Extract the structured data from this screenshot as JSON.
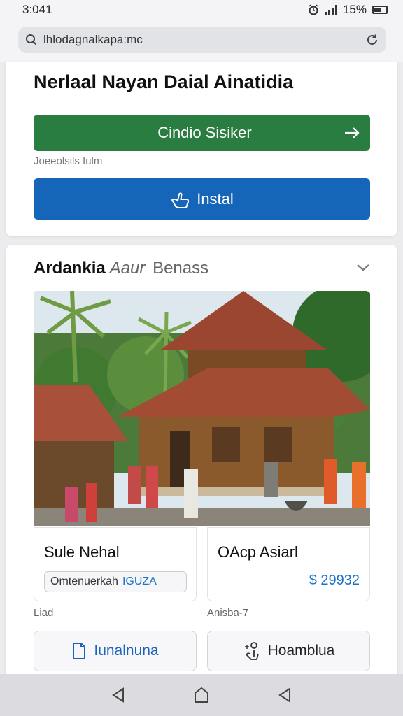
{
  "status": {
    "time": "3:041",
    "battery": "15%"
  },
  "browser": {
    "url": "lhlodagnalkapa:mc"
  },
  "header": {
    "title": "Nerlaal Nayan Daial Ainatidia",
    "primary_button": "Cindio Sisiker",
    "caption": "Joeeolsils Iulm",
    "install_button": "Instal"
  },
  "section": {
    "title_bold": "Ardankia",
    "title_italic": "Aaur",
    "title_rest": "Benass",
    "left_card": {
      "title": "Sule Nehal",
      "chip": "Omtenuerkah",
      "chip_accent": "IGUZA"
    },
    "right_card": {
      "title": "OAcp Asiarl",
      "price": "$ 29932"
    },
    "meta_left": "Liad",
    "meta_right": "Anisba-7",
    "left_button": "Iunalnuna",
    "right_button": "Hoamblua"
  },
  "colors": {
    "green": "#2a7d40",
    "blue": "#1566b8",
    "accent": "#1a73c8"
  }
}
